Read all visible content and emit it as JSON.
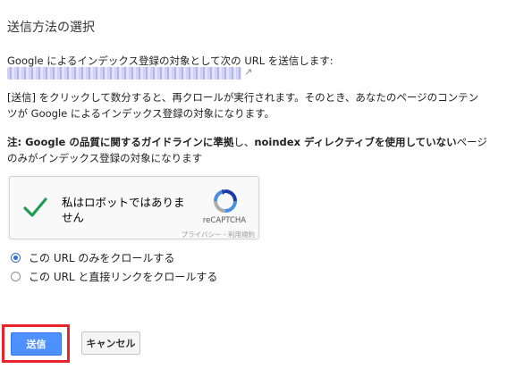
{
  "page": {
    "title": "送信方法の選択",
    "intro": "Google によるインデックス登録の対象として次の URL を送信します:",
    "external_link_icon": "↗",
    "para_line1": "[送信] をクリックして数分すると、再クロールが実行されます。そのとき、あなたのページのコンテン",
    "para_line2": "ツが Google によるインデックス登録の対象になります。",
    "note_bold1": "注: Google の品質に関するガイドラインに準拠",
    "note_plain1": "し、",
    "note_bold2": "noindex ディレクティブを使用していない",
    "note_plain2": "ページ",
    "note_line2": "のみがインデックス登録の対象になります"
  },
  "recaptcha": {
    "label": "私はロボットではありません",
    "brand": "reCAPTCHA",
    "links": "プライバシー - 利用規約",
    "check_icon": "checkmark-icon",
    "logo_icon": "recaptcha-logo-icon",
    "checked": true
  },
  "options": [
    {
      "label": "この URL のみをクロールする",
      "selected": true
    },
    {
      "label": "この URL と直接リンクをクロールする",
      "selected": false
    }
  ],
  "buttons": {
    "submit": "送信",
    "cancel": "キャンセル"
  },
  "colors": {
    "primary": "#4d90fe",
    "highlight": "#e8232a",
    "check": "#1e9e55"
  }
}
